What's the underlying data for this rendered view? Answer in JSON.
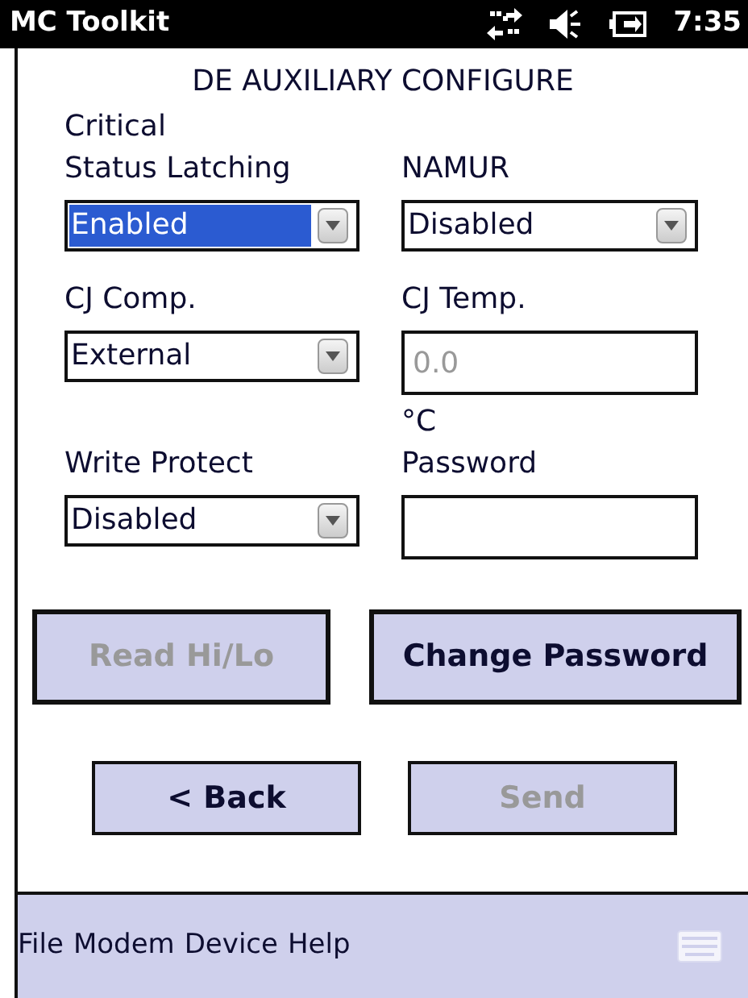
{
  "title_bar": {
    "title": "MC Toolkit",
    "time": "7:35"
  },
  "heading": "DE AUXILIARY CONFIGURE",
  "field_rows": [
    [
      {
        "kind": "dropdown",
        "label_lines": [
          "Critical",
          "Status Latching"
        ],
        "value": "Enabled",
        "selected": true
      },
      {
        "kind": "dropdown",
        "label_lines": [
          "NAMUR"
        ],
        "value": "Disabled",
        "selected": false
      }
    ],
    [
      {
        "kind": "dropdown",
        "label_lines": [
          "CJ Comp."
        ],
        "value": "External",
        "selected": false
      },
      {
        "kind": "text",
        "label_lines": [
          "CJ Temp."
        ],
        "value": "0.0",
        "disabled": true,
        "unit": "°C"
      }
    ],
    [
      {
        "kind": "dropdown",
        "label_lines": [
          "Write Protect"
        ],
        "value": "Disabled",
        "selected": false
      },
      {
        "kind": "text",
        "label_lines": [
          "Password"
        ]
      }
    ]
  ],
  "action_buttons": [
    {
      "label": "Read Hi/Lo",
      "disabled": true
    },
    {
      "label": "Change Password",
      "disabled": false
    }
  ],
  "nav_buttons": [
    {
      "label": "< Back",
      "disabled": false
    },
    {
      "label": "Send",
      "disabled": true
    }
  ],
  "menu": [
    "File",
    "Modem",
    "Device",
    "Help"
  ]
}
